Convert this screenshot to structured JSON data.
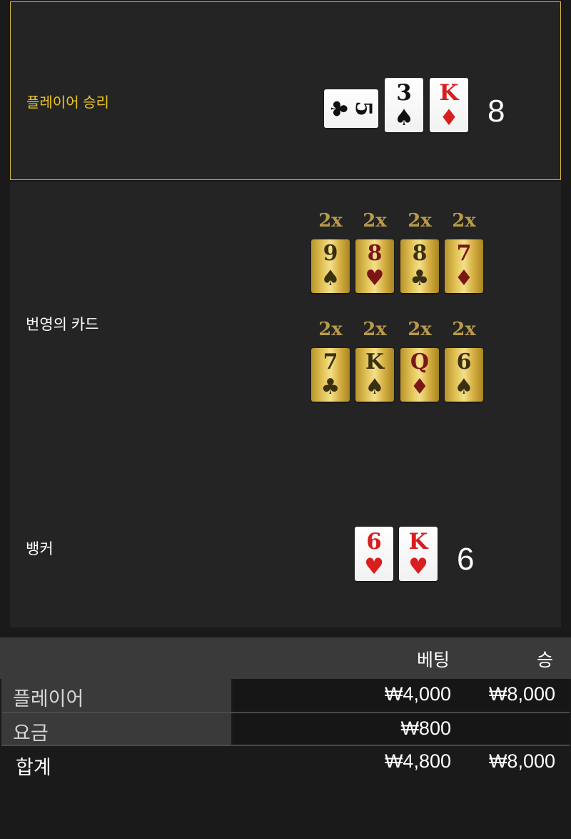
{
  "player": {
    "label": "플레이어 승리",
    "total": "8",
    "cards": [
      {
        "rank": "5",
        "suit": "♣",
        "color": "black",
        "orientation": "sideways"
      },
      {
        "rank": "3",
        "suit": "♠",
        "color": "black"
      },
      {
        "rank": "K",
        "suit": "♦",
        "color": "red"
      }
    ]
  },
  "lucky": {
    "label": "번영의 카드",
    "rows": [
      {
        "multipliers": [
          "2x",
          "2x",
          "2x",
          "2x"
        ],
        "cards": [
          {
            "rank": "9",
            "suit": "♠",
            "color": "black"
          },
          {
            "rank": "8",
            "suit": "♥",
            "color": "red"
          },
          {
            "rank": "8",
            "suit": "♣",
            "color": "black"
          },
          {
            "rank": "7",
            "suit": "♦",
            "color": "red"
          }
        ]
      },
      {
        "multipliers": [
          "2x",
          "2x",
          "2x",
          "2x"
        ],
        "cards": [
          {
            "rank": "7",
            "suit": "♣",
            "color": "black"
          },
          {
            "rank": "K",
            "suit": "♠",
            "color": "black"
          },
          {
            "rank": "Q",
            "suit": "♦",
            "color": "red"
          },
          {
            "rank": "6",
            "suit": "♠",
            "color": "black"
          }
        ]
      }
    ]
  },
  "banker": {
    "label": "뱅커",
    "total": "6",
    "cards": [
      {
        "rank": "6",
        "suit": "♥",
        "color": "red"
      },
      {
        "rank": "K",
        "suit": "♥",
        "color": "red"
      }
    ]
  },
  "summary": {
    "headers": {
      "bet": "베팅",
      "win": "승"
    },
    "rows": [
      {
        "label": "플레이어",
        "bet": "₩4,000",
        "win": "₩8,000"
      },
      {
        "label": "요금",
        "bet": "₩800",
        "win": ""
      }
    ],
    "total": {
      "label": "합계",
      "bet": "₩4,800",
      "win": "₩8,000"
    }
  },
  "colors": {
    "accent": "#ecc523",
    "card_red": "#d81e1e",
    "gold": "#e3c458"
  }
}
